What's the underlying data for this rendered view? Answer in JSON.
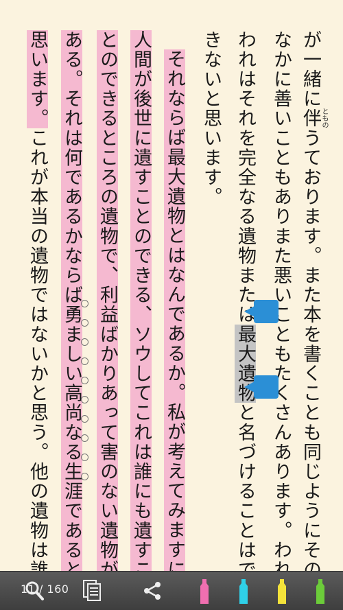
{
  "reader": {
    "ruby_text": "ともの",
    "columns": [
      {
        "text": "が一緒に伴うております。また本を書くことも同じようにその",
        "highlight": "none"
      },
      {
        "text": "なかに善いこともありまた悪いこともたくさんあります。われ",
        "highlight": "none"
      },
      {
        "text": "われはそれを完全なる遺物または最大遺物と名づけることはで",
        "highlight": "selection"
      },
      {
        "text": "きないと思います。",
        "highlight": "none"
      },
      {
        "text": "",
        "highlight": "none"
      },
      {
        "text": "それならば最大遺物とはなんであるか。私が考えてみますに",
        "highlight": "pink"
      },
      {
        "text": "人間が後世に遺すことのできる、ソウしてこれは誰にも遺すこ",
        "highlight": "pink"
      },
      {
        "text": "とのできるところの遺物で、利益ばかりあって害のない遺物が",
        "highlight": "pink"
      },
      {
        "text": "ある。それは何であるかならば勇ましい高尚なる生涯であると",
        "highlight": "pink"
      },
      {
        "text": "思います。これが本当の遺物ではないかと思う。他の遺物は誰",
        "highlight": "partial"
      }
    ]
  },
  "toolbar": {
    "page_current": "11",
    "page_total": "160",
    "page_separator": " / ",
    "search_icon": "search-icon",
    "toc_icon": "document-list-icon",
    "share_icon": "share-icon",
    "marker_colors": [
      "#f06fb0",
      "#2fd0e8",
      "#f3e23a",
      "#6ccc3a"
    ]
  }
}
